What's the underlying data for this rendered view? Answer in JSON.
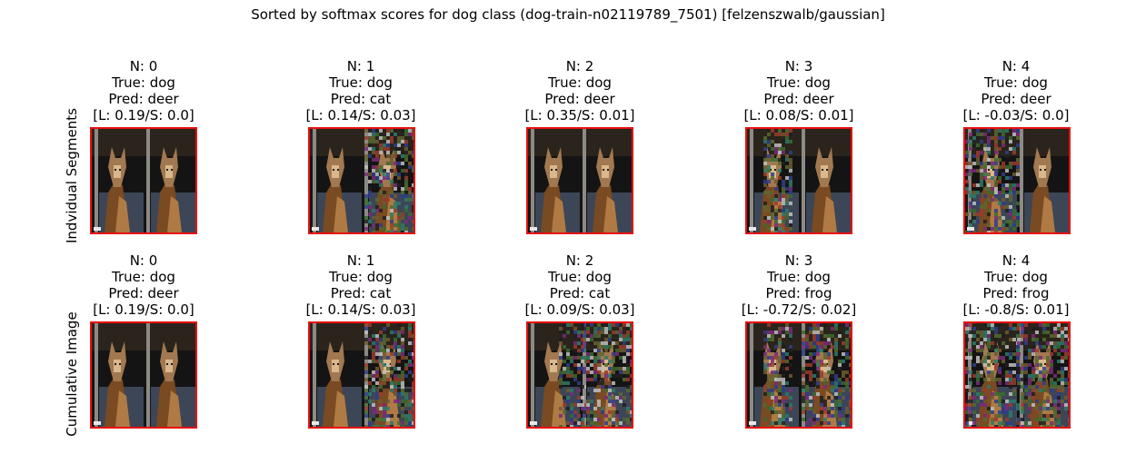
{
  "figure": {
    "title": "Sorted by softmax scores for dog class (dog-train-n02119789_7501) [felzenszwalb/gaussian]",
    "frame_color": "#e81010"
  },
  "rows": [
    {
      "label": "Indvidual Segments",
      "panels": [
        {
          "n": "N: 0",
          "true_label": "True: dog",
          "pred": "Pred: deer",
          "scores": "[L: 0.19/S: 0.0]",
          "noise": "none"
        },
        {
          "n": "N: 1",
          "true_label": "True: dog",
          "pred": "Pred: cat",
          "scores": "[L: 0.14/S: 0.03]",
          "noise": "right"
        },
        {
          "n": "N: 2",
          "true_label": "True: dog",
          "pred": "Pred: deer",
          "scores": "[L: 0.35/S: 0.01]",
          "noise": "none"
        },
        {
          "n": "N: 3",
          "true_label": "True: dog",
          "pred": "Pred: deer",
          "scores": "[L: 0.08/S: 0.01]",
          "noise": "left-strip"
        },
        {
          "n": "N: 4",
          "true_label": "True: dog",
          "pred": "Pred: deer",
          "scores": "[L: -0.03/S: 0.0]",
          "noise": "left"
        }
      ]
    },
    {
      "label": "Cumulative Image",
      "panels": [
        {
          "n": "N: 0",
          "true_label": "True: dog",
          "pred": "Pred: deer",
          "scores": "[L: 0.19/S: 0.0]",
          "noise": "none"
        },
        {
          "n": "N: 1",
          "true_label": "True: dog",
          "pred": "Pred: cat",
          "scores": "[L: 0.14/S: 0.03]",
          "noise": "right"
        },
        {
          "n": "N: 2",
          "true_label": "True: dog",
          "pred": "Pred: cat",
          "scores": "[L: 0.09/S: 0.03]",
          "noise": "right-heavy"
        },
        {
          "n": "N: 3",
          "true_label": "True: dog",
          "pred": "Pred: frog",
          "scores": "[L: -0.72/S: 0.02]",
          "noise": "both"
        },
        {
          "n": "N: 4",
          "true_label": "True: dog",
          "pred": "Pred: frog",
          "scores": "[L: -0.8/S: 0.01]",
          "noise": "all"
        }
      ]
    }
  ]
}
